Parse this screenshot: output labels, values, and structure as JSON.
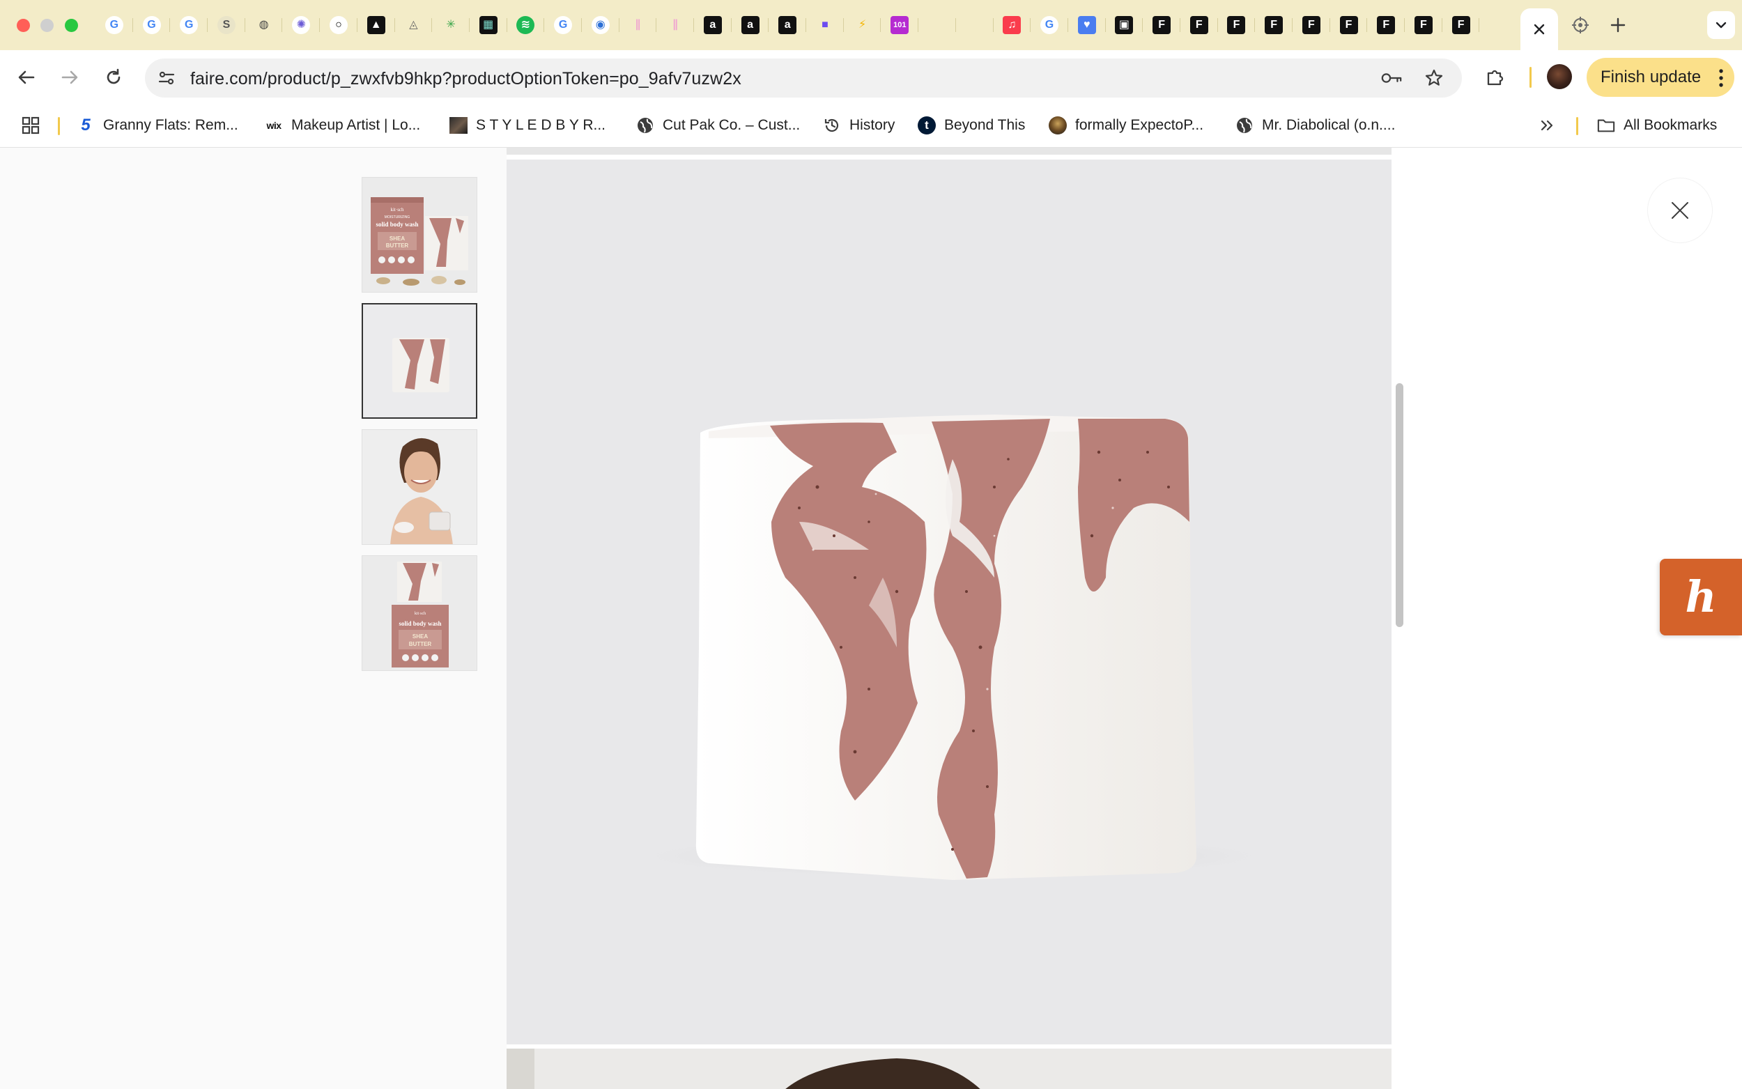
{
  "browser": {
    "tabs": [
      {
        "icon": "google-icon",
        "glyph": "G",
        "color": "#4285f4",
        "bg": "#ffffff"
      },
      {
        "icon": "google-icon",
        "glyph": "G",
        "color": "#4285f4",
        "bg": "#ffffff"
      },
      {
        "icon": "google-icon",
        "glyph": "G",
        "color": "#4285f4",
        "bg": "#ffffff"
      },
      {
        "icon": "script-s-icon",
        "glyph": "S",
        "color": "#555555",
        "bg": "#e9e4c8"
      },
      {
        "icon": "globe-icon",
        "glyph": "◍",
        "color": "#444444",
        "bg": "#f3ecc8"
      },
      {
        "icon": "gear-badge-icon",
        "glyph": "✺",
        "color": "#6b5bd6",
        "bg": "#ffffff"
      },
      {
        "icon": "ring-icon",
        "glyph": "○",
        "color": "#000000",
        "bg": "#ffffff"
      },
      {
        "icon": "ascend-icon",
        "glyph": "▲",
        "color": "#ffffff",
        "bg": "#111111"
      },
      {
        "icon": "mountain-icon",
        "glyph": "◬",
        "color": "#666666",
        "bg": "#f3ecc8"
      },
      {
        "icon": "sparkle-icon",
        "glyph": "✳",
        "color": "#3aa64a",
        "bg": "#f3ecc8"
      },
      {
        "icon": "gallery-icon",
        "glyph": "▦",
        "color": "#7ad7c8",
        "bg": "#111111"
      },
      {
        "icon": "spotify-icon",
        "glyph": "≋",
        "color": "#ffffff",
        "bg": "#1db954"
      },
      {
        "icon": "google-icon",
        "glyph": "G",
        "color": "#4285f4",
        "bg": "#ffffff"
      },
      {
        "icon": "circle-app-icon",
        "glyph": "◉",
        "color": "#2b6fd6",
        "bg": "#ffffff"
      },
      {
        "icon": "pink-link-icon",
        "glyph": "∥",
        "color": "#f0a6d0",
        "bg": "#f3ecc8"
      },
      {
        "icon": "pink-link-icon",
        "glyph": "∥",
        "color": "#f0a6d0",
        "bg": "#f3ecc8"
      },
      {
        "icon": "amazon-icon",
        "glyph": "a",
        "color": "#ffffff",
        "bg": "#111111"
      },
      {
        "icon": "amazon-icon",
        "glyph": "a",
        "color": "#ffffff",
        "bg": "#111111"
      },
      {
        "icon": "amazon-icon",
        "glyph": "a",
        "color": "#ffffff",
        "bg": "#111111"
      },
      {
        "icon": "video-camera-icon",
        "glyph": "■",
        "color": "#6c4cf0",
        "bg": "#f3ecc8"
      },
      {
        "icon": "bolt-icon",
        "glyph": "⚡",
        "color": "#f5b400",
        "bg": "#f3ecc8"
      },
      {
        "icon": "one-oh-one-icon",
        "glyph": "101",
        "color": "#ffffff",
        "bg": "#b52bd1"
      },
      {
        "icon": "blank-tab-icon",
        "glyph": "",
        "color": "#000000",
        "bg": "#f3ecc8"
      },
      {
        "icon": "blank-tab-icon",
        "glyph": "",
        "color": "#000000",
        "bg": "#f3ecc8"
      },
      {
        "icon": "music-icon",
        "glyph": "♫",
        "color": "#ffffff",
        "bg": "#fa3c4c"
      },
      {
        "icon": "google-icon",
        "glyph": "G",
        "color": "#4285f4",
        "bg": "#ffffff"
      },
      {
        "icon": "heart-chat-icon",
        "glyph": "♥",
        "color": "#ffffff",
        "bg": "#4a7df0"
      },
      {
        "icon": "square-app-icon",
        "glyph": "▣",
        "color": "#ffffff",
        "bg": "#111111"
      },
      {
        "icon": "faire-icon",
        "glyph": "F",
        "color": "#ffffff",
        "bg": "#111111"
      },
      {
        "icon": "faire-icon",
        "glyph": "F",
        "color": "#ffffff",
        "bg": "#111111"
      },
      {
        "icon": "faire-icon",
        "glyph": "F",
        "color": "#ffffff",
        "bg": "#111111"
      },
      {
        "icon": "faire-icon",
        "glyph": "F",
        "color": "#ffffff",
        "bg": "#111111"
      },
      {
        "icon": "faire-icon",
        "glyph": "F",
        "color": "#ffffff",
        "bg": "#111111"
      },
      {
        "icon": "faire-icon",
        "glyph": "F",
        "color": "#ffffff",
        "bg": "#111111"
      },
      {
        "icon": "faire-icon",
        "glyph": "F",
        "color": "#ffffff",
        "bg": "#111111"
      },
      {
        "icon": "faire-icon",
        "glyph": "F",
        "color": "#ffffff",
        "bg": "#111111"
      },
      {
        "icon": "faire-icon",
        "glyph": "F",
        "color": "#ffffff",
        "bg": "#111111"
      }
    ],
    "active_tab_icon": "close-tab-icon",
    "url": "faire.com/product/p_zwxfvb9hkp?productOptionToken=po_9afv7uzw2x",
    "finish_update_label": "Finish update",
    "bookmarks": [
      {
        "icon": "five-icon",
        "label": "Granny Flats: Rem..."
      },
      {
        "icon": "wix-icon",
        "label": "Makeup Artist | Lo..."
      },
      {
        "icon": "photo-icon",
        "label": "S T Y L E D B Y R..."
      },
      {
        "icon": "globe-icon",
        "label": "Cut Pak Co. – Cust..."
      },
      {
        "icon": "history-icon",
        "label": "History"
      },
      {
        "icon": "tumblr-icon",
        "label": "Beyond This"
      },
      {
        "icon": "avatar-icon",
        "label": "formally ExpectoP..."
      },
      {
        "icon": "globe-icon",
        "label": "Mr. Diabolical (o.n...."
      }
    ],
    "all_bookmarks_label": "All Bookmarks"
  },
  "product": {
    "thumbnails": [
      {
        "name": "thumbnail-box-and-bar",
        "selected": false
      },
      {
        "name": "thumbnail-bar",
        "selected": true
      },
      {
        "name": "thumbnail-model",
        "selected": false
      },
      {
        "name": "thumbnail-bar-on-box",
        "selected": false
      }
    ],
    "thumbnail_box_text": {
      "brand": "kit·sch",
      "subtitle": "MOISTURIZING",
      "name": "solid body wash",
      "variant_line1": "SHEA",
      "variant_line2": "BUTTER"
    },
    "main_image": "swirled pink and white soap bar",
    "colors": {
      "soap_white": "#f3f1ee",
      "soap_pink": "#b98079",
      "image_bg": "#e8e8ea",
      "honey_orange": "#d4622a"
    }
  }
}
